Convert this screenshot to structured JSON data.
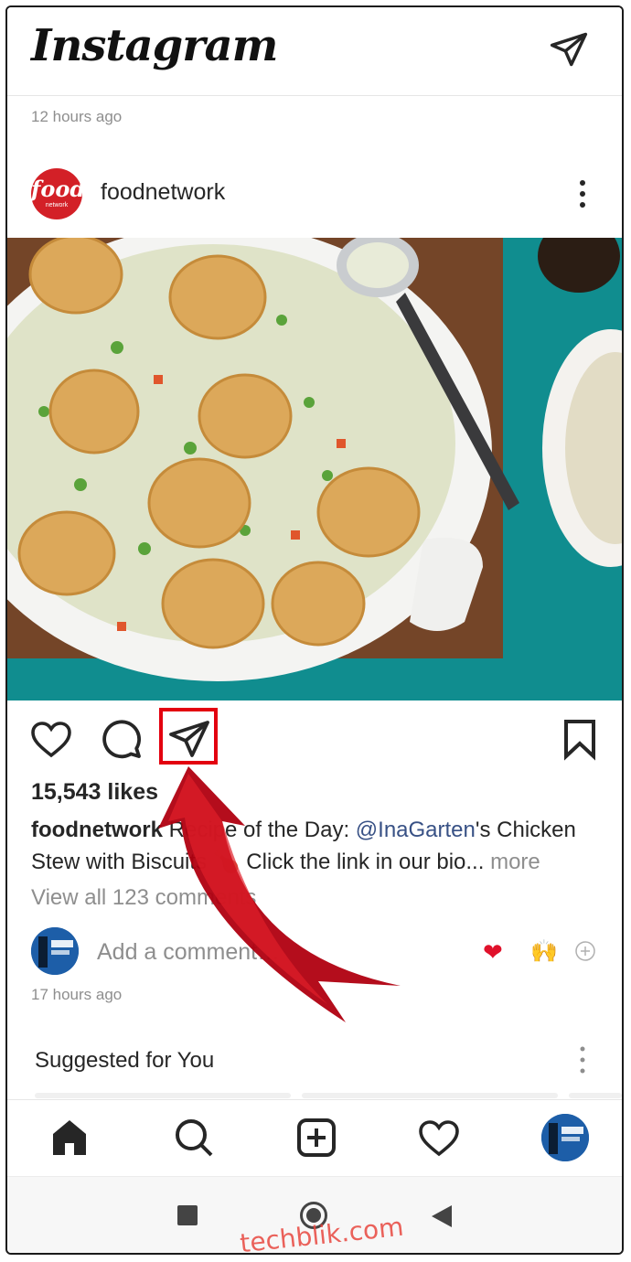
{
  "header": {
    "logo_text": "Instagram",
    "icon": "direct-message-icon"
  },
  "feed": {
    "top_timestamp": "12 hours ago"
  },
  "post": {
    "avatar": {
      "line1": "food",
      "line2": "network"
    },
    "username": "foodnetwork",
    "likes": "15,543 likes",
    "caption": {
      "user": "foodnetwork",
      "text_before": " Recipe of the Day: ",
      "mention": "@InaGarten",
      "text_after": "'s Chicken Stew with Biscuits 🍗 Click the link in our bio",
      "ellipsis": "...",
      "more": " more"
    },
    "view_comments": "View all 123 comments",
    "add_comment_placeholder": "Add a comment…",
    "quick_emoji_1": "❤",
    "quick_emoji_2": "🙌",
    "timestamp": "17 hours ago"
  },
  "suggested": {
    "title": "Suggested for You"
  },
  "bottom_nav": {
    "items": [
      "home-icon",
      "search-icon",
      "add-post-icon",
      "activity-heart-icon",
      "profile-avatar"
    ]
  },
  "system_nav": {
    "items": [
      "recents-button",
      "home-button",
      "back-button"
    ]
  },
  "watermark": "techblik.com",
  "colors": {
    "highlight": "#e3000f",
    "arrow": "#c0000c",
    "mention": "#385185",
    "muted": "#8e8e8e",
    "food_brand": "#d32027"
  }
}
